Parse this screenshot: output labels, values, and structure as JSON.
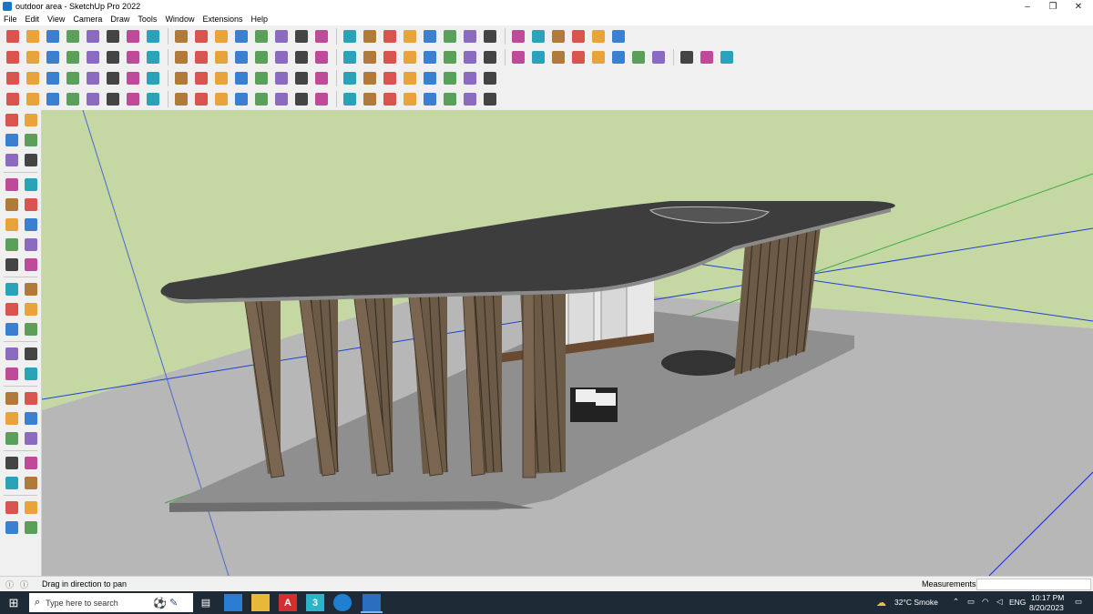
{
  "window": {
    "title": "outdoor area - SketchUp Pro 2022",
    "minimize": "–",
    "maximize": "❐",
    "close": "✕"
  },
  "menu": [
    "File",
    "Edit",
    "View",
    "Camera",
    "Draw",
    "Tools",
    "Window",
    "Extensions",
    "Help"
  ],
  "toolbar_icons": {
    "row1": [
      "zoom-icon",
      "select-icon",
      "line-icon",
      "arc-icon",
      "rectangle-icon",
      "push-pull-icon",
      "follow-me-icon",
      "move-icon",
      "rotate-icon",
      "scale-icon",
      "tape-measure-icon",
      "dimension-icon",
      "protractor-icon",
      "orbit-icon",
      "pan-icon",
      "zoom-window-icon",
      "zoom-extents-icon",
      "xray-icon",
      "layers-icon",
      "section-icon",
      "components-icon",
      "styles-icon",
      "warehouse-icon",
      "extension-icon",
      "materials-icon",
      "shadows-icon",
      "paint-icon",
      "undo-icon",
      "redo-icon",
      "scenes-icon"
    ],
    "row2": [
      "box-icon",
      "solid-icon",
      "union-icon",
      "subtract-icon",
      "trim-icon",
      "intersect-icon",
      "split-icon",
      "outer-shell-icon",
      "sandbox-icon",
      "from-contours-icon",
      "stamp-icon",
      "drape-icon",
      "add-detail-icon",
      "flip-edge-icon",
      "make-group-icon",
      "house-icon",
      "home-icon",
      "paste-icon",
      "shape-icon",
      "circle-icon",
      "polygon-icon",
      "rotated-rect-icon",
      "freehand-icon",
      "offset-icon",
      "paint-bucket-icon",
      "eraser-icon",
      "walk-icon",
      "look-around-icon",
      "position-camera-icon",
      "text-icon",
      "3d-text-icon",
      "axes-icon",
      "guide-icon",
      "section-plane-icon",
      "fill-icon"
    ],
    "row3": [
      "cube-icon",
      "pyramid-icon",
      "cone-icon",
      "cylinder-icon",
      "sphere-icon",
      "torus-icon",
      "helix-icon",
      "pipe-icon",
      "bezier-icon",
      "spline-icon",
      "polyline-icon",
      "curve-icon",
      "loft-icon",
      "extrude-icon",
      "sweep-icon",
      "shell-icon",
      "bend-icon",
      "twist-icon",
      "taper-icon",
      "shear-icon",
      "bulge-icon",
      "lattice-icon",
      "smooth-icon",
      "subdivide-icon"
    ]
  },
  "left_toolbar": [
    [
      "select-tool-icon",
      "orbit-tool-icon"
    ],
    [
      "paint-tool-icon",
      "eraser-tool-icon"
    ],
    [
      "components-tool-icon",
      "tag-tool-icon"
    ],
    [
      "line-tool-icon",
      "freehand-tool-icon"
    ],
    [
      "rectangle-tool-icon",
      "rotated-rect-tool-icon"
    ],
    [
      "circle-tool-icon",
      "polygon-tool-icon"
    ],
    [
      "arc-tool-icon",
      "pie-tool-icon"
    ],
    [
      "two-point-arc-tool-icon",
      "three-point-arc-tool-icon"
    ],
    [
      "move-tool-icon",
      "push-pull-tool-icon"
    ],
    [
      "rotate-tool-icon",
      "follow-me-tool-icon"
    ],
    [
      "scale-tool-icon",
      "offset-tool-icon"
    ],
    [
      "tape-tool-icon",
      "dimension-tool-icon"
    ],
    [
      "protractor-tool-icon",
      "text-tool-icon"
    ],
    [
      "orbit-view-icon",
      "pan-tool-icon"
    ],
    [
      "zoom-tool-icon",
      "zoom-window-tool-icon"
    ],
    [
      "zoom-extents-tool-icon",
      "previous-view-icon"
    ],
    [
      "position-camera-tool-icon",
      "look-around-tool-icon"
    ],
    [
      "walk-tool-icon",
      "section-tool-icon"
    ],
    [
      "axes-tool-icon",
      "guide-tool-icon"
    ],
    [
      "sandbox-tool-icon",
      "stamp-tool-icon"
    ]
  ],
  "status": {
    "hint": "Drag in direction to pan",
    "measurements_label": "Measurements"
  },
  "taskbar": {
    "search_placeholder": "Type here to search",
    "weather": "32°C  Smoke",
    "language": "ENG",
    "time": "10:17 PM",
    "date": "8/20/2023"
  },
  "colors": {
    "sky": "#c5d8a3",
    "ground": "#b7b7b7",
    "roof": "#3f3f3f",
    "wood": "#7a6650",
    "axis_red": "#d03030",
    "axis_green": "#3aaa3a",
    "axis_blue": "#2040d0",
    "taskbar": "#1f2a37"
  }
}
